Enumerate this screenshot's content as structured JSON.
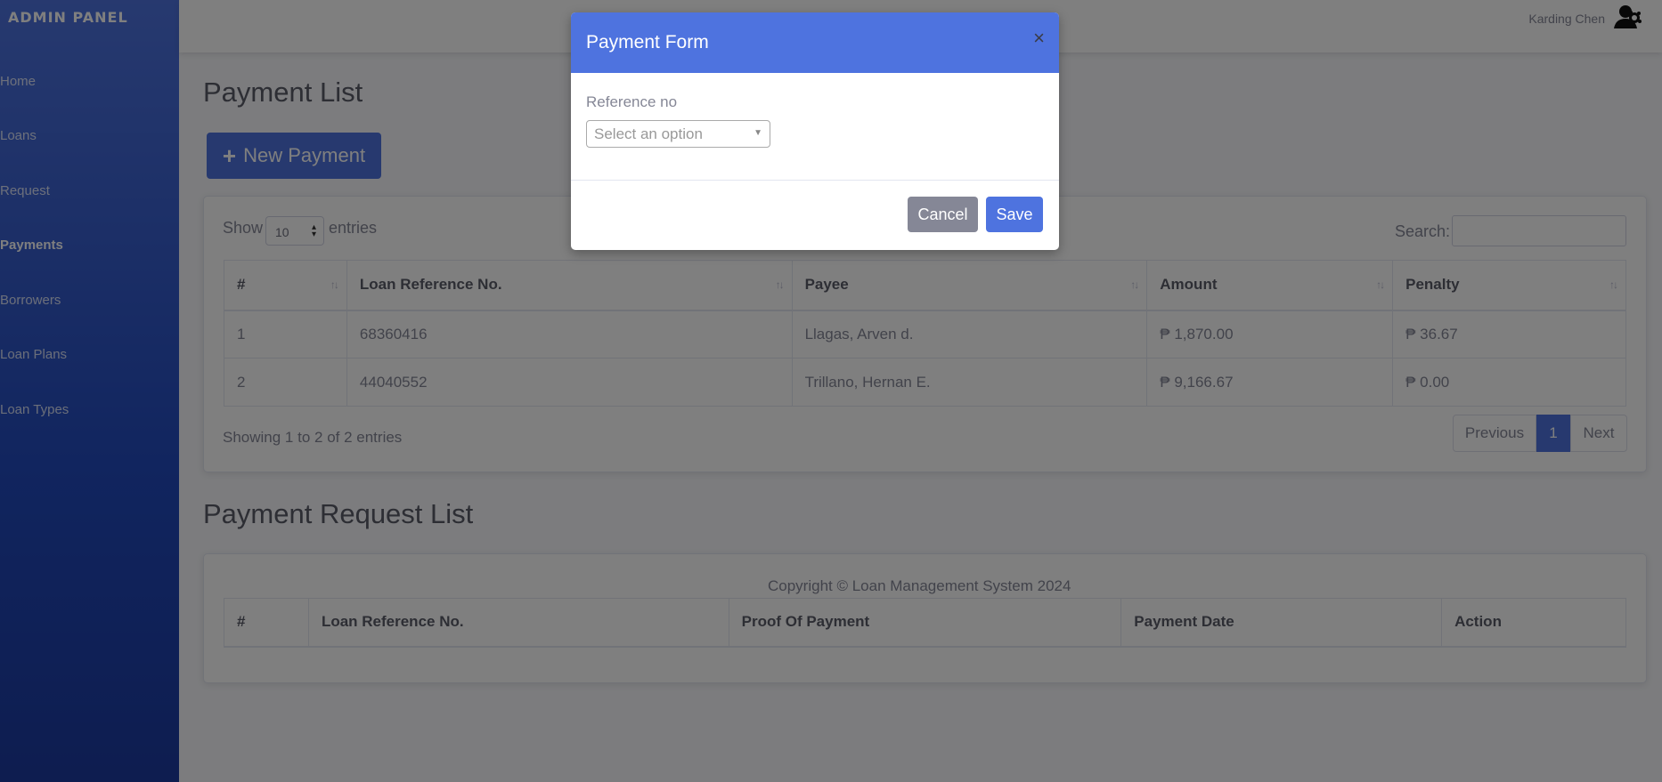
{
  "sidebar": {
    "brand": "ADMIN PANEL",
    "items": [
      {
        "label": "Home",
        "active": false
      },
      {
        "label": "Loans",
        "active": false
      },
      {
        "label": "Request",
        "active": false
      },
      {
        "label": "Payments",
        "active": true
      },
      {
        "label": "Borrowers",
        "active": false
      },
      {
        "label": "Loan Plans",
        "active": false
      },
      {
        "label": "Loan Types",
        "active": false
      }
    ]
  },
  "topbar": {
    "user_name": "Karding Chen",
    "avatar_icon": "user-avatar-icon"
  },
  "payment_list": {
    "title": "Payment List",
    "new_button": "New Payment",
    "show_label": "Show",
    "entries_value": "10",
    "entries_label": "entries",
    "search_label": "Search:",
    "columns": [
      "#",
      "Loan Reference No.",
      "Payee",
      "Amount",
      "Penalty"
    ],
    "rows": [
      [
        "1",
        "68360416",
        "Llagas, Arven d.",
        "₱ 1,870.00",
        "₱ 36.67"
      ],
      [
        "2",
        "44040552",
        "Trillano, Hernan E.",
        "₱ 9,166.67",
        "₱ 0.00"
      ]
    ],
    "showing": "Showing 1 to 2 of 2 entries",
    "pager": {
      "previous": "Previous",
      "page": "1",
      "next": "Next"
    }
  },
  "request_list": {
    "title": "Payment Request List",
    "columns": [
      "#",
      "Loan Reference No.",
      "Proof Of Payment",
      "Payment Date",
      "Action"
    ]
  },
  "footer": {
    "copyright": "Copyright © Loan Management System 2024"
  },
  "modal": {
    "title": "Payment Form",
    "close": "×",
    "ref_label": "Reference no",
    "ref_placeholder": "Select an option",
    "cancel": "Cancel",
    "save": "Save"
  },
  "colors": {
    "primary": "#4e73df",
    "secondary": "#858796",
    "sidebar_dark": "#1c3aa0"
  }
}
